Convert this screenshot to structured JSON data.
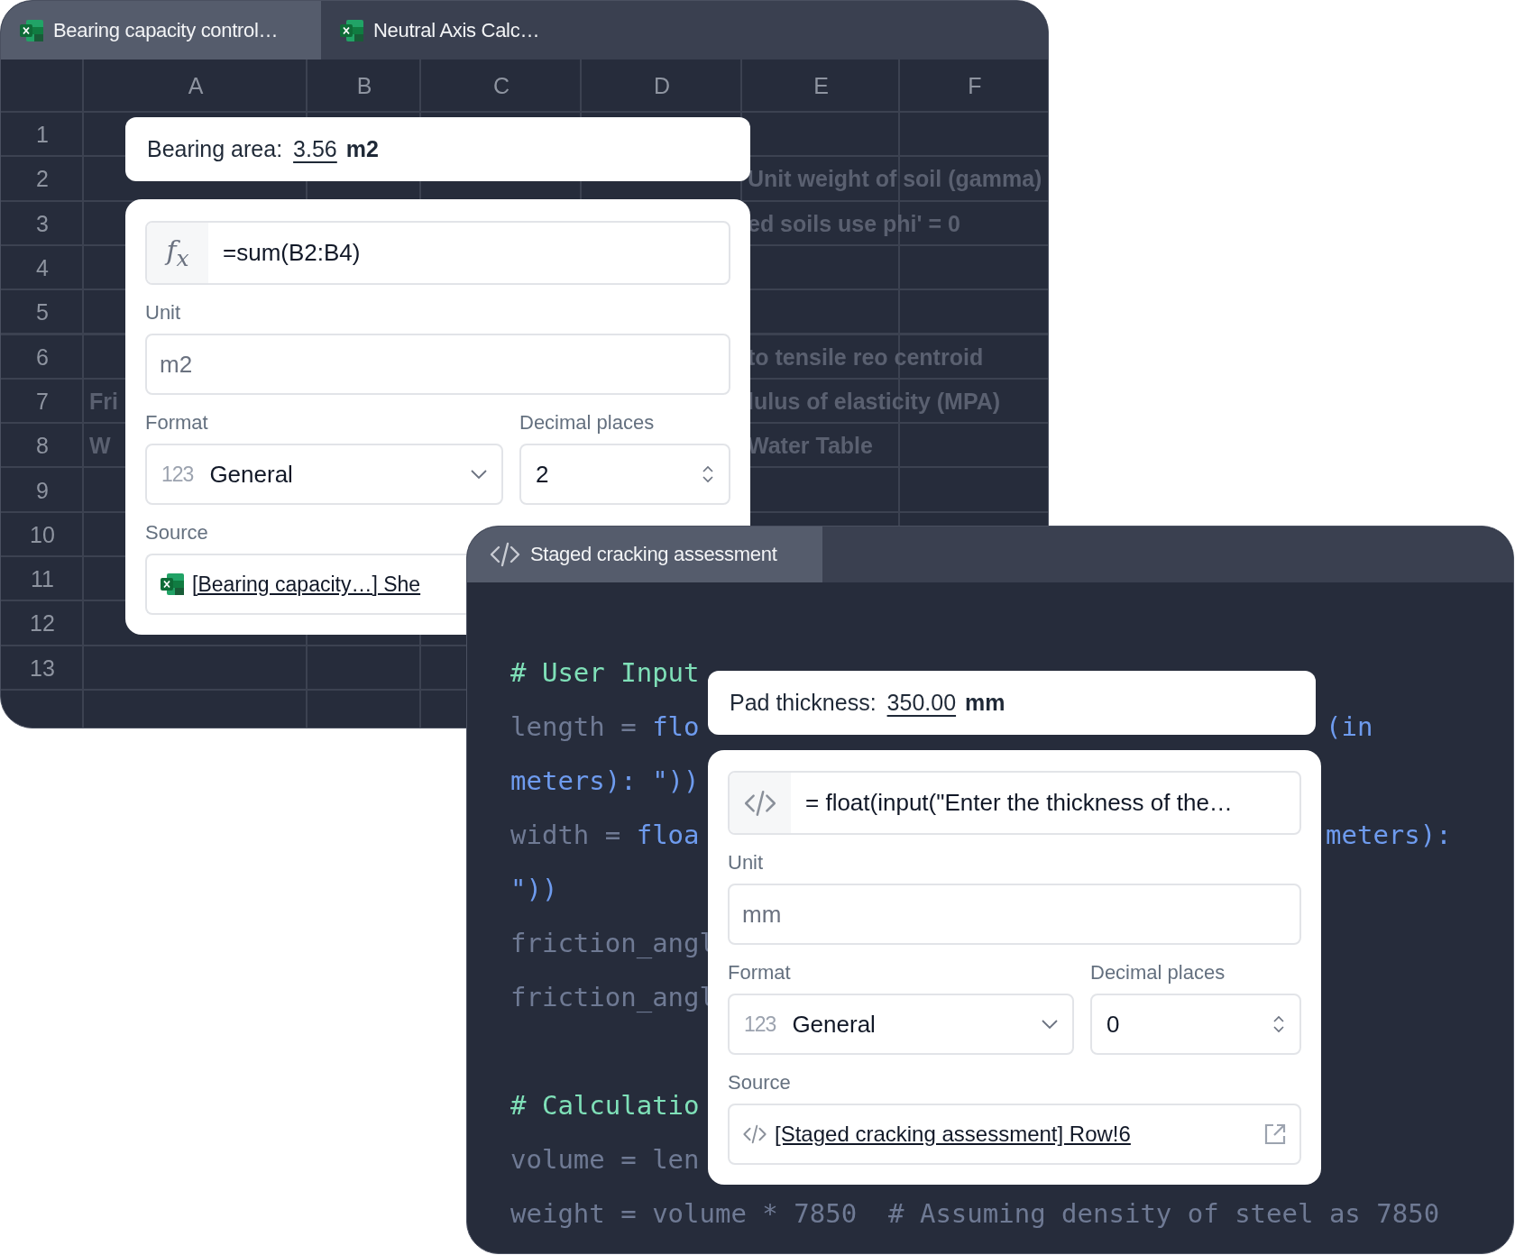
{
  "spreadsheet_window": {
    "tabs": [
      {
        "label": "Bearing capacity control…",
        "selected": true
      },
      {
        "label": "Neutral Axis Calc…",
        "selected": false
      }
    ],
    "columns": [
      "A",
      "B",
      "C",
      "D",
      "E",
      "F"
    ],
    "rows": [
      {
        "label": "1"
      },
      {
        "label": "2",
        "cells": [
          null,
          null,
          null,
          null,
          "Unit weight of soil (gamma)",
          null
        ]
      },
      {
        "label": "3",
        "cells": [
          null,
          null,
          null,
          null,
          "ed soils use phi' = 0",
          null
        ]
      },
      {
        "label": "4"
      },
      {
        "label": "5"
      },
      {
        "label": "6",
        "cells": [
          null,
          null,
          null,
          null,
          "to tensile reo centroid",
          null
        ]
      },
      {
        "label": "7",
        "cells": [
          "Fri",
          null,
          null,
          null,
          "lulus of elasticity (MPA)",
          null
        ]
      },
      {
        "label": "8",
        "cells": [
          "W",
          null,
          null,
          null,
          "Water Table",
          null
        ]
      },
      {
        "label": "9"
      },
      {
        "label": "10"
      },
      {
        "label": "11"
      },
      {
        "label": "12"
      },
      {
        "label": "13"
      }
    ],
    "popup": {
      "result_label": "Bearing area:",
      "result_value": "3.56",
      "result_unit": "m2",
      "formula_icon": "f$_{x}$",
      "formula": "=sum(B2:B4)",
      "unit_label": "Unit",
      "unit_value": "m2",
      "format_label": "Format",
      "format_icon": "123",
      "format": "General",
      "decimal_label": "Decimal places",
      "decimal_value": "2",
      "source_label": "Source",
      "source": "[Bearing capacity…] She"
    }
  },
  "code_window": {
    "tab": {
      "label": "Staged cracking assessment",
      "selected": true
    },
    "lines": [
      {
        "kind": "code",
        "left": [
          {
            "text": "# User Input",
            "kind": "comment"
          }
        ]
      },
      {
        "kind": "code",
        "left": [
          {
            "text": "length = ",
            "kind": "plain"
          },
          {
            "text": "flo",
            "kind": "call"
          }
        ],
        "right": [
          {
            "text": "(in",
            "kind": "call"
          }
        ]
      },
      {
        "kind": "code",
        "left": [
          {
            "text": "meters): \"))",
            "kind": "call"
          }
        ]
      },
      {
        "kind": "code",
        "left": [
          {
            "text": "width = ",
            "kind": "plain"
          },
          {
            "text": "floa",
            "kind": "call"
          }
        ],
        "right": [
          {
            "text": "meters):",
            "kind": "call"
          }
        ]
      },
      {
        "kind": "code",
        "left": [
          {
            "text": "\"))",
            "kind": "call"
          }
        ]
      },
      {
        "kind": "code",
        "left": [
          {
            "text": "friction_angl",
            "kind": "plain"
          }
        ]
      },
      {
        "kind": "code",
        "left": [
          {
            "text": "friction_angl",
            "kind": "plain"
          }
        ]
      },
      {
        "kind": "blank"
      },
      {
        "kind": "code",
        "left": [
          {
            "text": "# Calculatio",
            "kind": "comment"
          }
        ]
      },
      {
        "kind": "code",
        "left": [
          {
            "text": "volume = len",
            "kind": "plain"
          }
        ]
      },
      {
        "kind": "code",
        "left": [
          {
            "text": "weight = volume * 7850  # Assuming density of steel as 7850",
            "kind": "plain"
          }
        ]
      }
    ],
    "popup": {
      "result_label": "Pad thickness:",
      "result_value": "350.00",
      "result_unit": "mm",
      "formula": "= float(input(\"Enter the thickness of the…",
      "unit_label": "Unit",
      "unit_value": "mm",
      "format_label": "Format",
      "format_icon": "123",
      "format": "General",
      "decimal_label": "Decimal places",
      "decimal_value": "0",
      "source_label": "Source",
      "source": "[Staged cracking assessment] Row!6"
    }
  }
}
